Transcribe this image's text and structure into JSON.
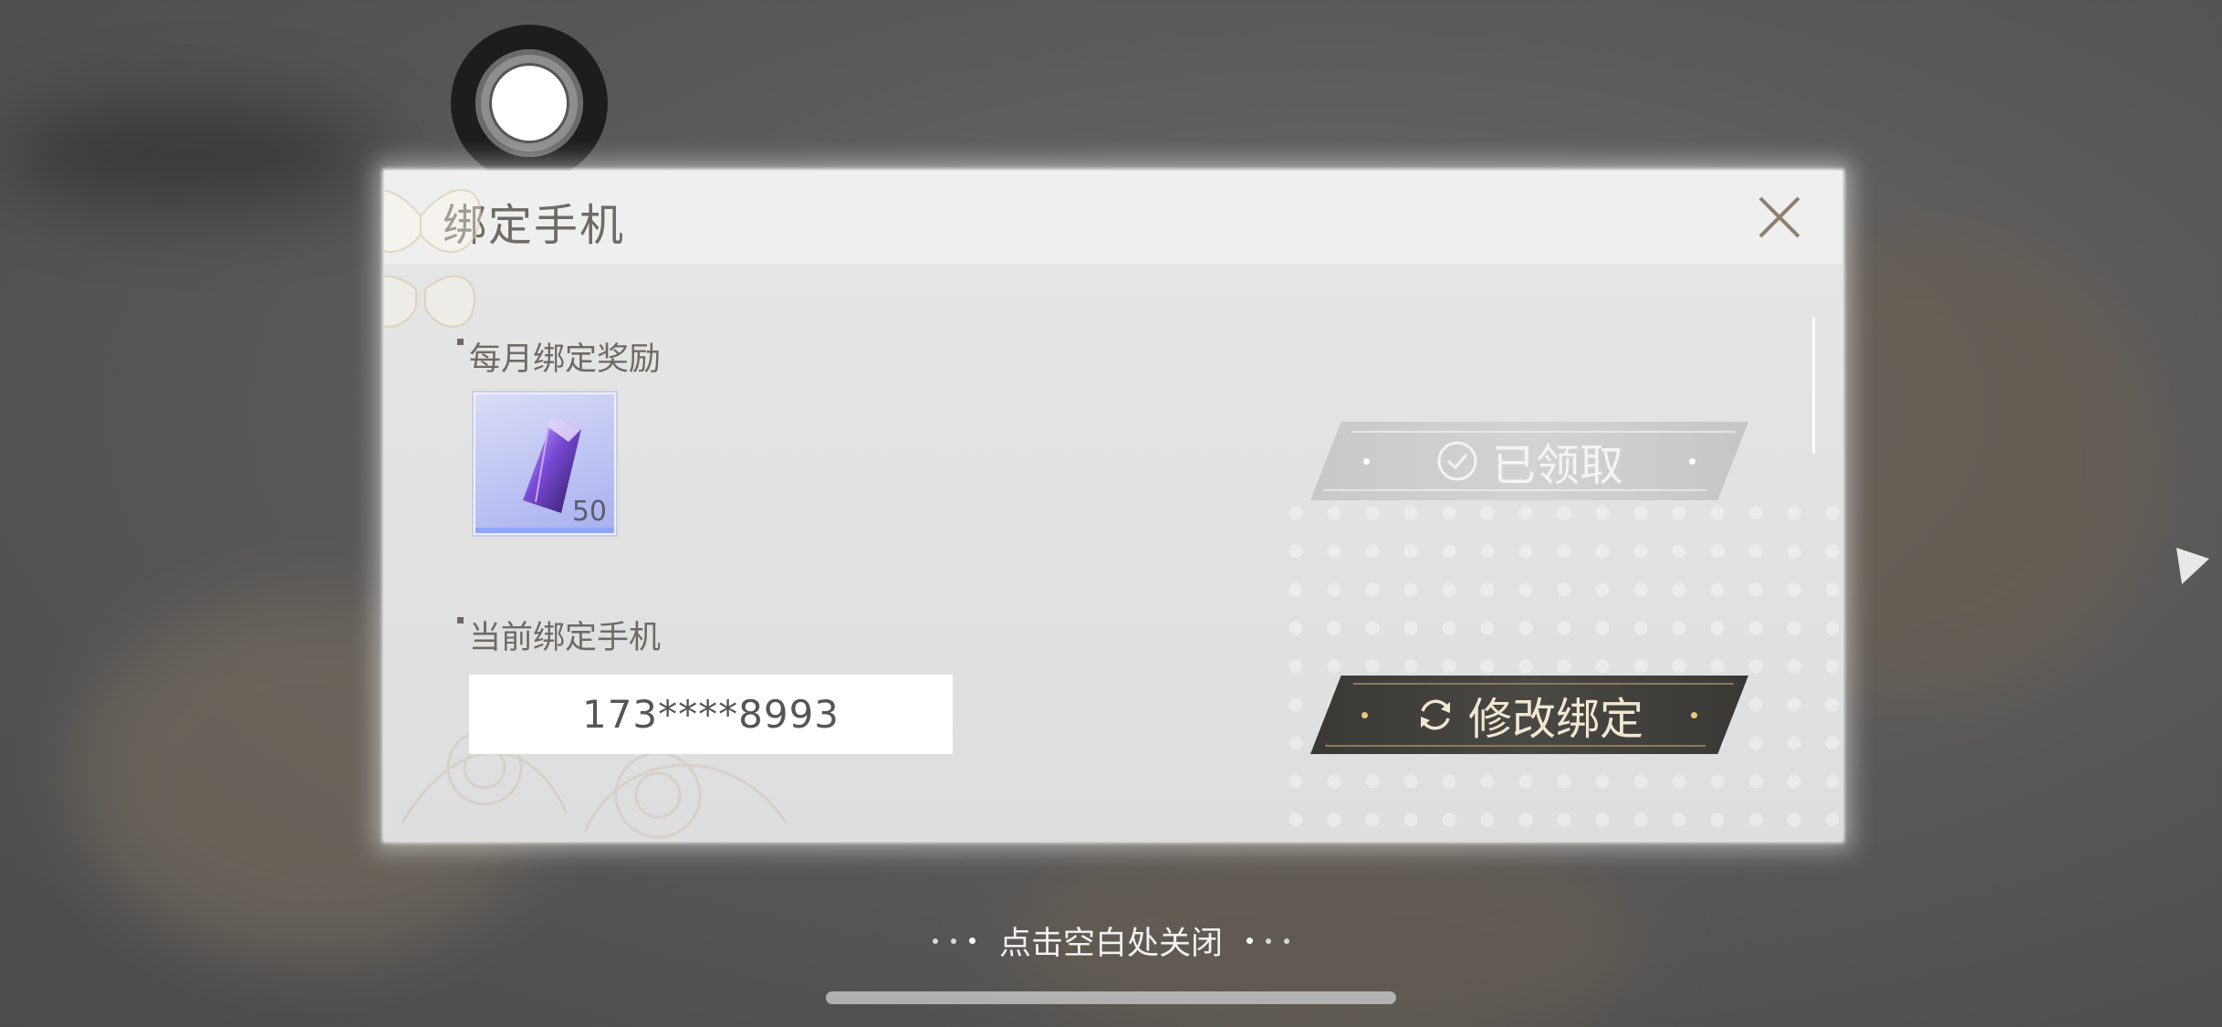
{
  "dialog": {
    "title": "绑定手机",
    "close_icon": "close-icon"
  },
  "reward_section": {
    "label": "每月绑定奖励",
    "item": {
      "icon": "crystal-icon",
      "count": "50"
    },
    "claim_button": {
      "label": "已领取",
      "icon": "check-circle-icon",
      "state": "claimed"
    }
  },
  "phone_section": {
    "label": "当前绑定手机",
    "phone_number": "173****8993",
    "modify_button": {
      "label": "修改绑定",
      "icon": "refresh-icon"
    }
  },
  "footer": {
    "close_hint": "点击空白处关闭"
  },
  "colors": {
    "label_text": "#6e6a64",
    "claimed_button": "#c8c8c8",
    "modify_button": "#3a3835",
    "modify_accent": "#e8c979"
  }
}
